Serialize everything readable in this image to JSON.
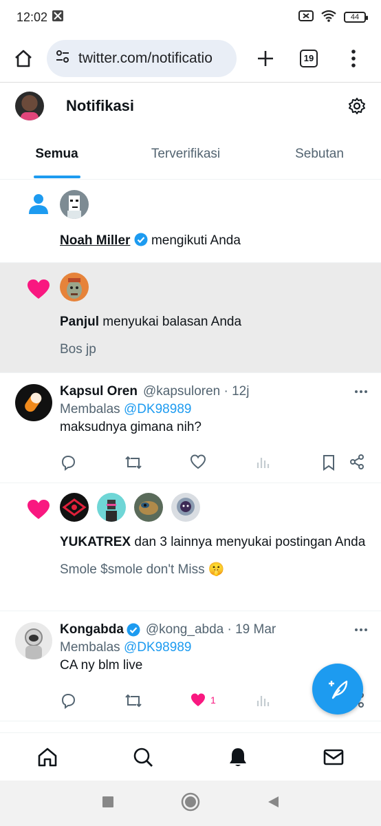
{
  "status_bar": {
    "time": "12:02",
    "battery": "44"
  },
  "browser": {
    "url": "twitter.com/notificatio",
    "tab_count": "19"
  },
  "header": {
    "title": "Notifikasi"
  },
  "tabs": [
    {
      "label": "Semua",
      "active": true
    },
    {
      "label": "Terverifikasi",
      "active": false
    },
    {
      "label": "Sebutan",
      "active": false
    }
  ],
  "notifications": [
    {
      "type": "follow",
      "icon": "person-icon",
      "user": "Noah Miller",
      "verified": true,
      "action": "mengikuti Anda"
    },
    {
      "type": "like",
      "icon": "heart-icon",
      "user": "Panjul",
      "action": "menyukai balasan Anda",
      "snippet": "Bos jp",
      "highlighted": true
    },
    {
      "type": "tweet",
      "name": "Kapsul Oren",
      "handle": "@kapsuloren · 12j",
      "reply_prefix": "Membalas",
      "reply_to": "@DK98989",
      "body": "maksudnya gimana nih?"
    },
    {
      "type": "like",
      "icon": "heart-icon",
      "user": "YUKATREX",
      "action": "dan 3 lainnya menyukai postingan Anda",
      "snippet": "Smole $smole don't Miss 🤫"
    },
    {
      "type": "tweet",
      "name": "Kongabda",
      "verified": true,
      "handle": "@kong_abda · 19 Mar",
      "reply_prefix": "Membalas",
      "reply_to": "@DK98989",
      "body": "CA ny blm live",
      "like_count": "1"
    }
  ],
  "colors": {
    "accent": "#1d9bf0",
    "like": "#f91880",
    "highlight_bg": "#ebebeb"
  },
  "bottom_nav": [
    "home-icon",
    "search-icon",
    "bell-icon",
    "mail-icon"
  ]
}
